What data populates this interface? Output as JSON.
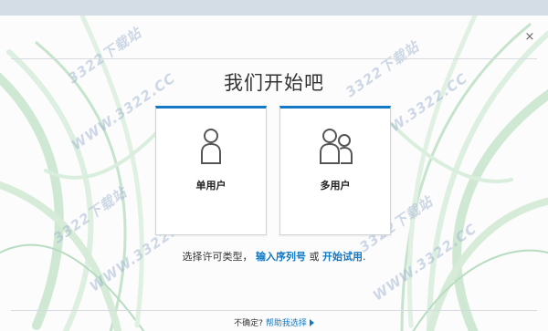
{
  "dialog": {
    "title": "我们开始吧",
    "close_icon": "×"
  },
  "options": {
    "single_label": "单用户",
    "multi_label": "多用户"
  },
  "prompt": {
    "prefix": "选择许可类型，",
    "serial_link": "输入序列号",
    "or": " 或 ",
    "trial_link": "开始试用",
    "suffix": "."
  },
  "footer": {
    "question": "不确定?",
    "help_link": "帮助我选择"
  },
  "watermarks": [
    "WWW.3322.CC",
    "3322下载站",
    "WWW.3322.CC",
    "3322下载站",
    "WWW.3322.CC",
    "3322下载站",
    "WWW.3322.CC",
    "3322下载站"
  ],
  "colors": {
    "accent": "#1479c4",
    "topbar": "#d4dde6"
  }
}
